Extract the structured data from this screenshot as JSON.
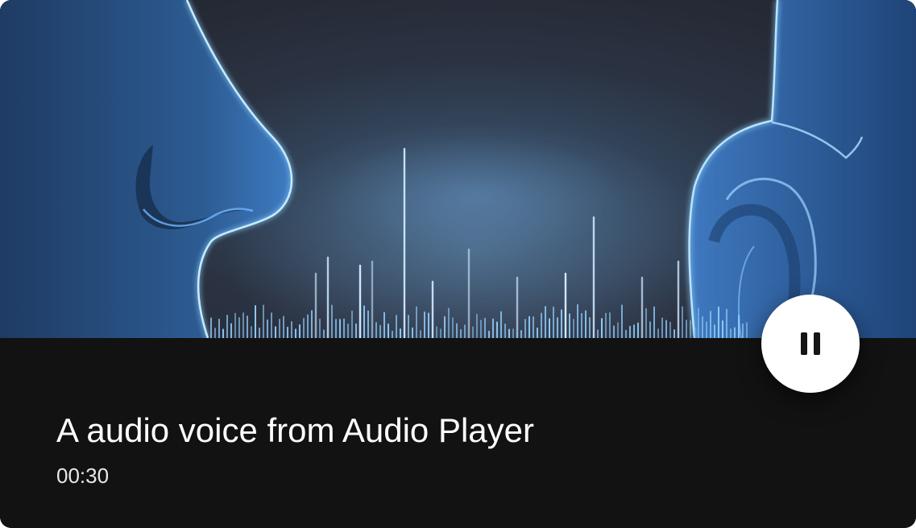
{
  "player": {
    "title": "A audio voice from Audio Player",
    "duration": "00:30",
    "state": "playing",
    "control_icon": "pause-icon"
  },
  "artwork": {
    "subject": "glowing nose and ear with sound wave",
    "accent_color": "#6fb6ff"
  }
}
